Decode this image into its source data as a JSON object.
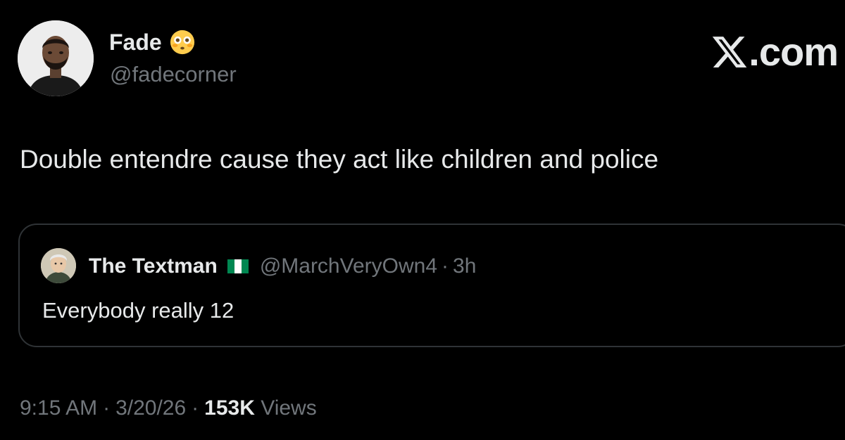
{
  "tweet": {
    "author": {
      "display_name": "Fade",
      "emoji": "flushed-face-emoji",
      "handle": "@fadecorner"
    },
    "brand": {
      "logo": "x-logo",
      "text": ".com"
    },
    "text": "Double entendre cause they act like children and police",
    "quote": {
      "display_name": "The Textman",
      "flag": "nigeria-flag",
      "handle": "@MarchVeryOwn4",
      "separator": "·",
      "time": "3h",
      "text": "Everybody really 12"
    },
    "meta": {
      "time": "9:15 AM",
      "separator": "·",
      "date": "3/20/26",
      "views_count": "153K",
      "views_label": "Views"
    }
  },
  "colors": {
    "background": "#000000",
    "primary_text": "#e7e9ea",
    "secondary_text": "#71767b",
    "border": "#2f3336",
    "flag_green": "#008751",
    "flag_white": "#ffffff"
  }
}
